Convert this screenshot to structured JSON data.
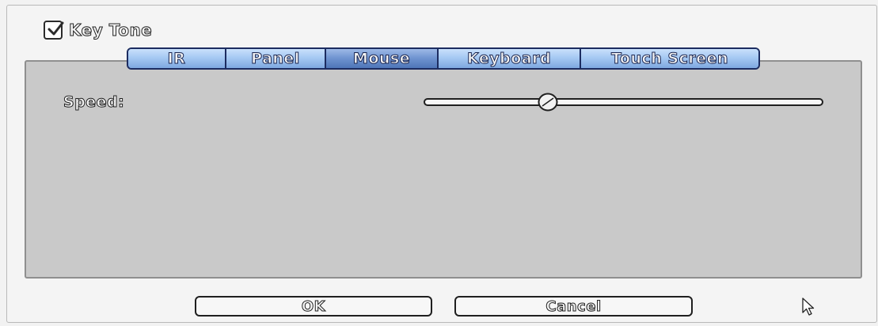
{
  "key_tone": {
    "label": "Key Tone",
    "checked": true,
    "icon": "checkmark-icon"
  },
  "tabs": [
    {
      "label": "IR"
    },
    {
      "label": "Panel"
    },
    {
      "label": "Mouse",
      "active": true
    },
    {
      "label": "Keyboard"
    },
    {
      "label": "Touch Screen"
    }
  ],
  "mouse": {
    "speed_label": "Speed:",
    "speed_value": 0.31
  },
  "buttons": {
    "ok": "OK",
    "cancel": "Cancel"
  },
  "colors": {
    "tab_accent": "#9ec3f0",
    "tab_active": "#6d92cf",
    "panel_bg": "#c9c9c9"
  }
}
